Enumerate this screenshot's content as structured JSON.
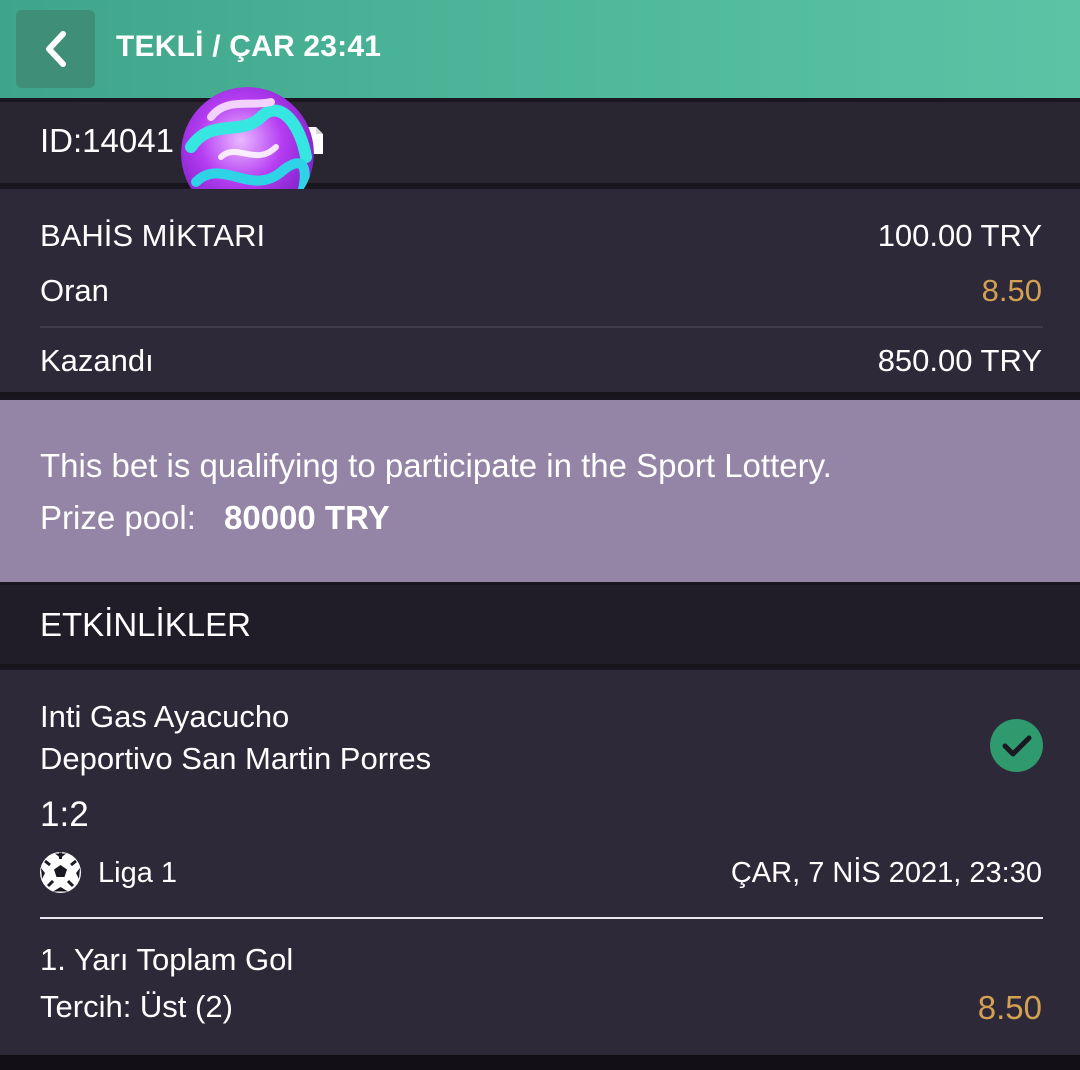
{
  "header": {
    "back_icon": "chevron-left-icon",
    "title": "TEKLİ / ÇAR 23:41"
  },
  "bet": {
    "id_label": "ID:14041",
    "copy_icon": "copy-icon"
  },
  "summary": {
    "stake_label": "BAHİS MİKTARI",
    "stake_value": "100.00 TRY",
    "odds_label": "Oran",
    "odds_value": "8.50",
    "won_label": "Kazandı",
    "won_value": "850.00 TRY"
  },
  "lottery": {
    "message": "This bet is qualifying to participate in the Sport Lottery.",
    "prize_label": "Prize pool:",
    "prize_value": "80000 TRY"
  },
  "events": {
    "title": "ETKİNLİKLER",
    "items": [
      {
        "home_team": "Inti Gas Ayacucho",
        "away_team": "Deportivo San Martin Porres",
        "score": "1:2",
        "status_icon": "check-circle-icon",
        "sport_icon": "soccer-ball-icon",
        "league": "Liga 1",
        "date": "ÇAR, 7 NİS 2021, 23:30",
        "market": "1. Yarı Toplam Gol",
        "pick": "Tercih: Üst (2)",
        "odds": "8.50"
      }
    ]
  },
  "colors": {
    "header_green": "#4eb79a",
    "odds_gold": "#d4a052",
    "lottery_bg": "#9484a5",
    "panel_bg": "#2d2938",
    "check_green": "#2f9a6e"
  }
}
